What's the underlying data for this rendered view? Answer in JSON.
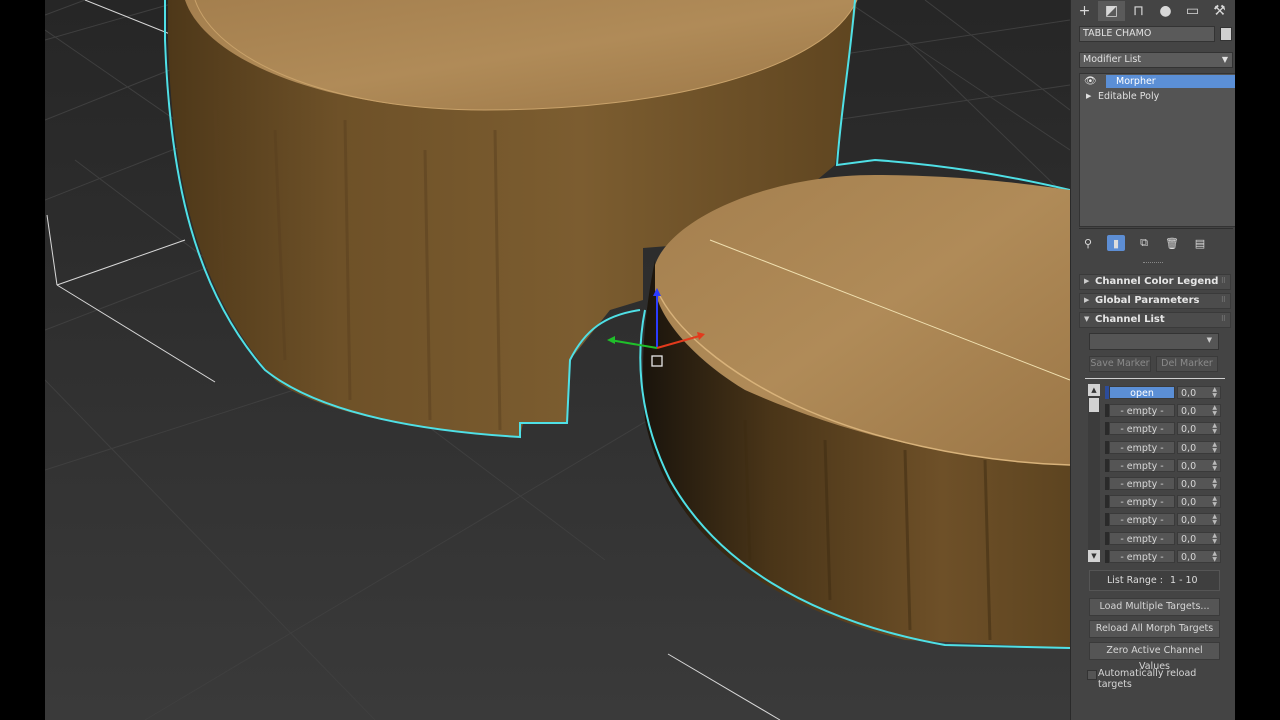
{
  "command_panel": {
    "tabs": [
      "create",
      "modify",
      "hierarchy",
      "motion",
      "display",
      "utilities"
    ],
    "object_name": "TABLE CHAMO",
    "modifier_list_label": "Modifier List",
    "stack": [
      {
        "label": "Morpher",
        "selected": true
      },
      {
        "label": "Editable Poly",
        "selected": false
      }
    ],
    "stack_tools": [
      "pin-stack",
      "show-end-result",
      "make-unique",
      "remove-modifier",
      "configure-modifier-sets"
    ]
  },
  "morpher": {
    "rollouts": {
      "legend": "Channel Color Legend",
      "global": "Global Parameters",
      "channel_list": "Channel List"
    },
    "save_marker": "Save Marker",
    "del_marker": "Del Marker",
    "channels": [
      {
        "name": "open",
        "value": "0,0"
      },
      {
        "name": "- empty -",
        "value": "0,0"
      },
      {
        "name": "- empty -",
        "value": "0,0"
      },
      {
        "name": "- empty -",
        "value": "0,0"
      },
      {
        "name": "- empty -",
        "value": "0,0"
      },
      {
        "name": "- empty -",
        "value": "0,0"
      },
      {
        "name": "- empty -",
        "value": "0,0"
      },
      {
        "name": "- empty -",
        "value": "0,0"
      },
      {
        "name": "- empty -",
        "value": "0,0"
      },
      {
        "name": "- empty -",
        "value": "0,0"
      }
    ],
    "list_range_label": "List Range :",
    "list_range_value": "1 - 10",
    "load_multiple": "Load Multiple Targets...",
    "reload_all": "Reload All Morph Targets",
    "zero_active": "Zero Active Channel Values",
    "auto_reload": "Automatically reload targets"
  },
  "colors": {
    "selection_accent": "#5b8fd6",
    "outline": "#4fe0e6",
    "viewport_bg": "#2e2e2e",
    "panel_bg": "#444444"
  }
}
